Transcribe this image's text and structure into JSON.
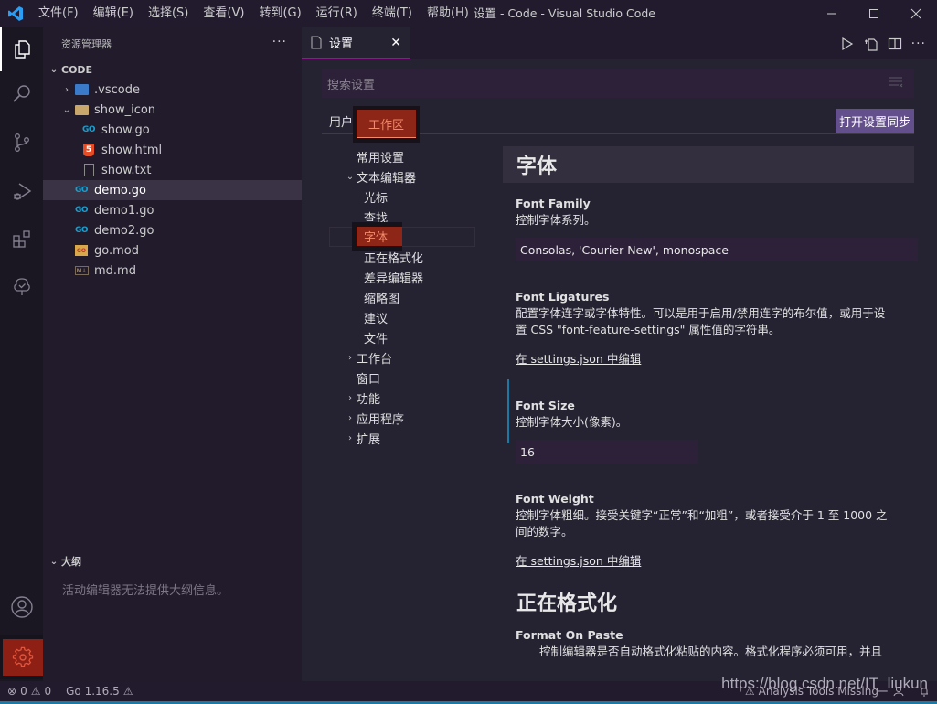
{
  "titlebar": {
    "window_title": "设置 - Code - Visual Studio Code",
    "menu": [
      "文件(F)",
      "编辑(E)",
      "选择(S)",
      "查看(V)",
      "转到(G)",
      "运行(R)",
      "终端(T)",
      "帮助(H)"
    ],
    "controls": {
      "minimize": "—",
      "maximize": "☐",
      "close": "✕"
    }
  },
  "activitybar": {
    "items": [
      "explorer-icon",
      "search-icon",
      "source-control-icon",
      "run-debug-icon",
      "extensions-icon",
      "testing-icon"
    ],
    "bottom": [
      "account-icon",
      "manage-gear-icon"
    ]
  },
  "sidebar": {
    "title": "资源管理器",
    "more": "···",
    "section": "CODE",
    "tree": [
      {
        "label": ".vscode",
        "icon": "vscode-folder-icon",
        "depth": 1,
        "chevron": "›"
      },
      {
        "label": "show_icon",
        "icon": "folder-open-icon",
        "depth": 1,
        "chevron": "⌄"
      },
      {
        "label": "show.go",
        "icon": "go-file-icon",
        "depth": 2
      },
      {
        "label": "show.html",
        "icon": "html-file-icon",
        "depth": 2
      },
      {
        "label": "show.txt",
        "icon": "text-file-icon",
        "depth": 2
      },
      {
        "label": "demo.go",
        "icon": "go-file-icon",
        "depth": 1,
        "selected": true
      },
      {
        "label": "demo1.go",
        "icon": "go-file-icon",
        "depth": 1
      },
      {
        "label": "demo2.go",
        "icon": "go-file-icon",
        "depth": 1
      },
      {
        "label": "go.mod",
        "icon": "go-mod-icon",
        "depth": 1
      },
      {
        "label": "md.md",
        "icon": "markdown-icon",
        "depth": 1
      }
    ],
    "outline": {
      "title": "大纲",
      "message": "活动编辑器无法提供大纲信息。"
    }
  },
  "editor": {
    "tab": {
      "label": "设置",
      "close": "✕"
    },
    "actions": [
      "run-icon",
      "open-settings-json-icon",
      "split-editor-icon",
      "more-actions-icon"
    ]
  },
  "settings": {
    "search_placeholder": "搜索设置",
    "scopes": {
      "user": "用户",
      "workspace": "工作区"
    },
    "sync_button": "打开设置同步",
    "toc": [
      {
        "label": "常用设置",
        "indent": 0
      },
      {
        "label": "文本编辑器",
        "indent": 0,
        "chevron": "⌄"
      },
      {
        "label": "光标",
        "indent": 1
      },
      {
        "label": "查找",
        "indent": 1
      },
      {
        "label": "字体",
        "indent": 1,
        "selected": true
      },
      {
        "label": "正在格式化",
        "indent": 1
      },
      {
        "label": "差异编辑器",
        "indent": 1
      },
      {
        "label": "缩略图",
        "indent": 1
      },
      {
        "label": "建议",
        "indent": 1
      },
      {
        "label": "文件",
        "indent": 1
      },
      {
        "label": "工作台",
        "indent": 0,
        "chevron": "›"
      },
      {
        "label": "窗口",
        "indent": 0
      },
      {
        "label": "功能",
        "indent": 0,
        "chevron": "›"
      },
      {
        "label": "应用程序",
        "indent": 0,
        "chevron": "›"
      },
      {
        "label": "扩展",
        "indent": 0,
        "chevron": "›"
      }
    ],
    "sections": {
      "font": {
        "header": "字体",
        "font_family": {
          "title": "Font Family",
          "desc": "控制字体系列。",
          "value": "Consolas, 'Courier New', monospace"
        },
        "font_ligatures": {
          "title": "Font Ligatures",
          "desc": "配置字体连字或字体特性。可以是用于启用/禁用连字的布尔值，或用于设置 CSS \"font-feature-settings\" 属性值的字符串。",
          "link": "在 settings.json 中编辑"
        },
        "font_size": {
          "title": "Font Size",
          "desc": "控制字体大小(像素)。",
          "value": "16"
        },
        "font_weight": {
          "title": "Font Weight",
          "desc": "控制字体粗细。接受关键字“正常”和“加粗”，或者接受介于 1 至 1000 之间的数字。",
          "link": "在 settings.json 中编辑"
        }
      },
      "formatting": {
        "header": "正在格式化",
        "format_on_paste": {
          "title": "Format On Paste",
          "desc": "控制编辑器是否自动格式化粘贴的内容。格式化程序必须可用，并且"
        }
      }
    }
  },
  "statusbar": {
    "errors": "0",
    "warnings": "0",
    "go_version": "Go 1.16.5",
    "analysis": "Analysis Tools Missing"
  },
  "watermark": "https://blog.csdn.net/IT_liukun",
  "colors": {
    "accent_tab_border": "#8e1a8e",
    "highlight_red": "#8e2618",
    "highlight_text": "#f38a6c",
    "sync_button": "#634f8c",
    "status_border": "#1b79a3"
  }
}
